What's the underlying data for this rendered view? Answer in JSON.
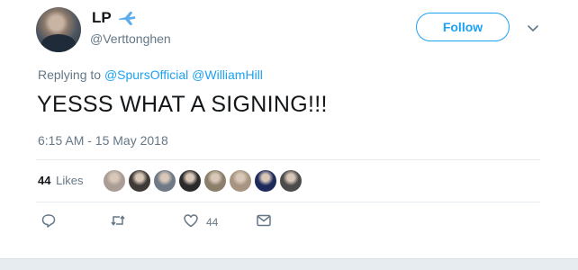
{
  "author": {
    "name": "LP",
    "emoji_icon": "airplane-icon",
    "handle": "@Verttonghen"
  },
  "follow_label": "Follow",
  "reply": {
    "prefix": "Replying to",
    "mentions": [
      "@SpursOfficial",
      "@WilliamHill"
    ]
  },
  "tweet_text": "YESSS WHAT A SIGNING!!!",
  "timestamp": "6:15 AM - 15 May 2018",
  "stats": {
    "likes_count": "44",
    "likes_label": "Likes"
  },
  "actions": {
    "like_count": "44"
  },
  "colors": {
    "accent": "#1da1f2",
    "muted": "#657786",
    "divider": "#e6ecf0"
  },
  "liker_avatar_colors": [
    "#a99d96",
    "#3f3a37",
    "#6f7a86",
    "#2a2a2a",
    "#8b7f6b",
    "#a89581",
    "#1f2a5c",
    "#4b4b4b"
  ]
}
